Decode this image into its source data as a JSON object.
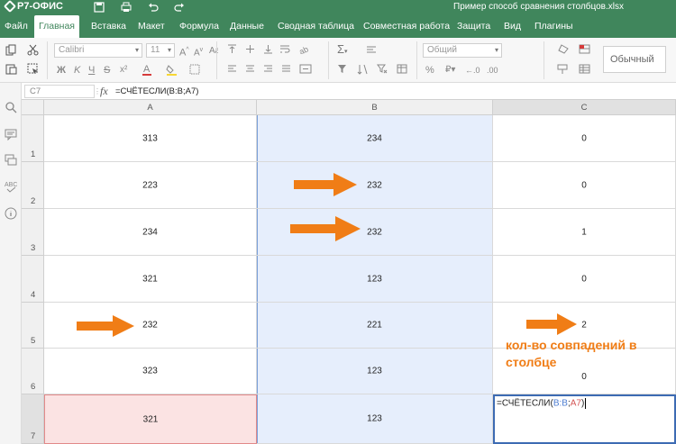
{
  "app": {
    "logo": "Р7-ОФИС",
    "document_title": "Пример способ сравнения столбцов.xlsx"
  },
  "menu": {
    "tabs": [
      {
        "label": "Файл"
      },
      {
        "label": "Главная"
      },
      {
        "label": "Вставка"
      },
      {
        "label": "Макет"
      },
      {
        "label": "Формула"
      },
      {
        "label": "Данные"
      },
      {
        "label": "Сводная таблица"
      },
      {
        "label": "Совместная работа"
      },
      {
        "label": "Защита"
      },
      {
        "label": "Вид"
      },
      {
        "label": "Плагины"
      }
    ],
    "active_tab": "Главная"
  },
  "toolbar": {
    "font_family": "Calibri",
    "font_size": "11",
    "number_format": "Общий",
    "cell_style": "Обычный"
  },
  "formula_bar": {
    "name_box": "C7",
    "fx_label": "fx",
    "formula": "=СЧЁТЕСЛИ(B:B;A7)"
  },
  "grid": {
    "columns": [
      "A",
      "B",
      "C"
    ],
    "rows": [
      {
        "num": "1",
        "a": "313",
        "b": "234",
        "c": "0"
      },
      {
        "num": "2",
        "a": "223",
        "b": "232",
        "c": "0"
      },
      {
        "num": "3",
        "a": "234",
        "b": "232",
        "c": "1"
      },
      {
        "num": "4",
        "a": "321",
        "b": "123",
        "c": "0"
      },
      {
        "num": "5",
        "a": "232",
        "b": "221",
        "c": "2"
      },
      {
        "num": "6",
        "a": "323",
        "b": "123",
        "c": "0"
      },
      {
        "num": "7",
        "a": "321",
        "b": "123",
        "c": ""
      }
    ],
    "editor": {
      "prefix": "=СЧЁТЕСЛИ(",
      "ref1": "B:B",
      "sep": ";",
      "ref2": "A7",
      "suffix": ")"
    }
  },
  "annotation": {
    "line1": "кол-во совпадений в",
    "line2": "столбце"
  },
  "colors": {
    "brand_green": "#40865c",
    "arrow_orange": "#f07d16",
    "column_b_highlight": "#e6eefc",
    "row7_highlight": "#fbe3e3"
  }
}
